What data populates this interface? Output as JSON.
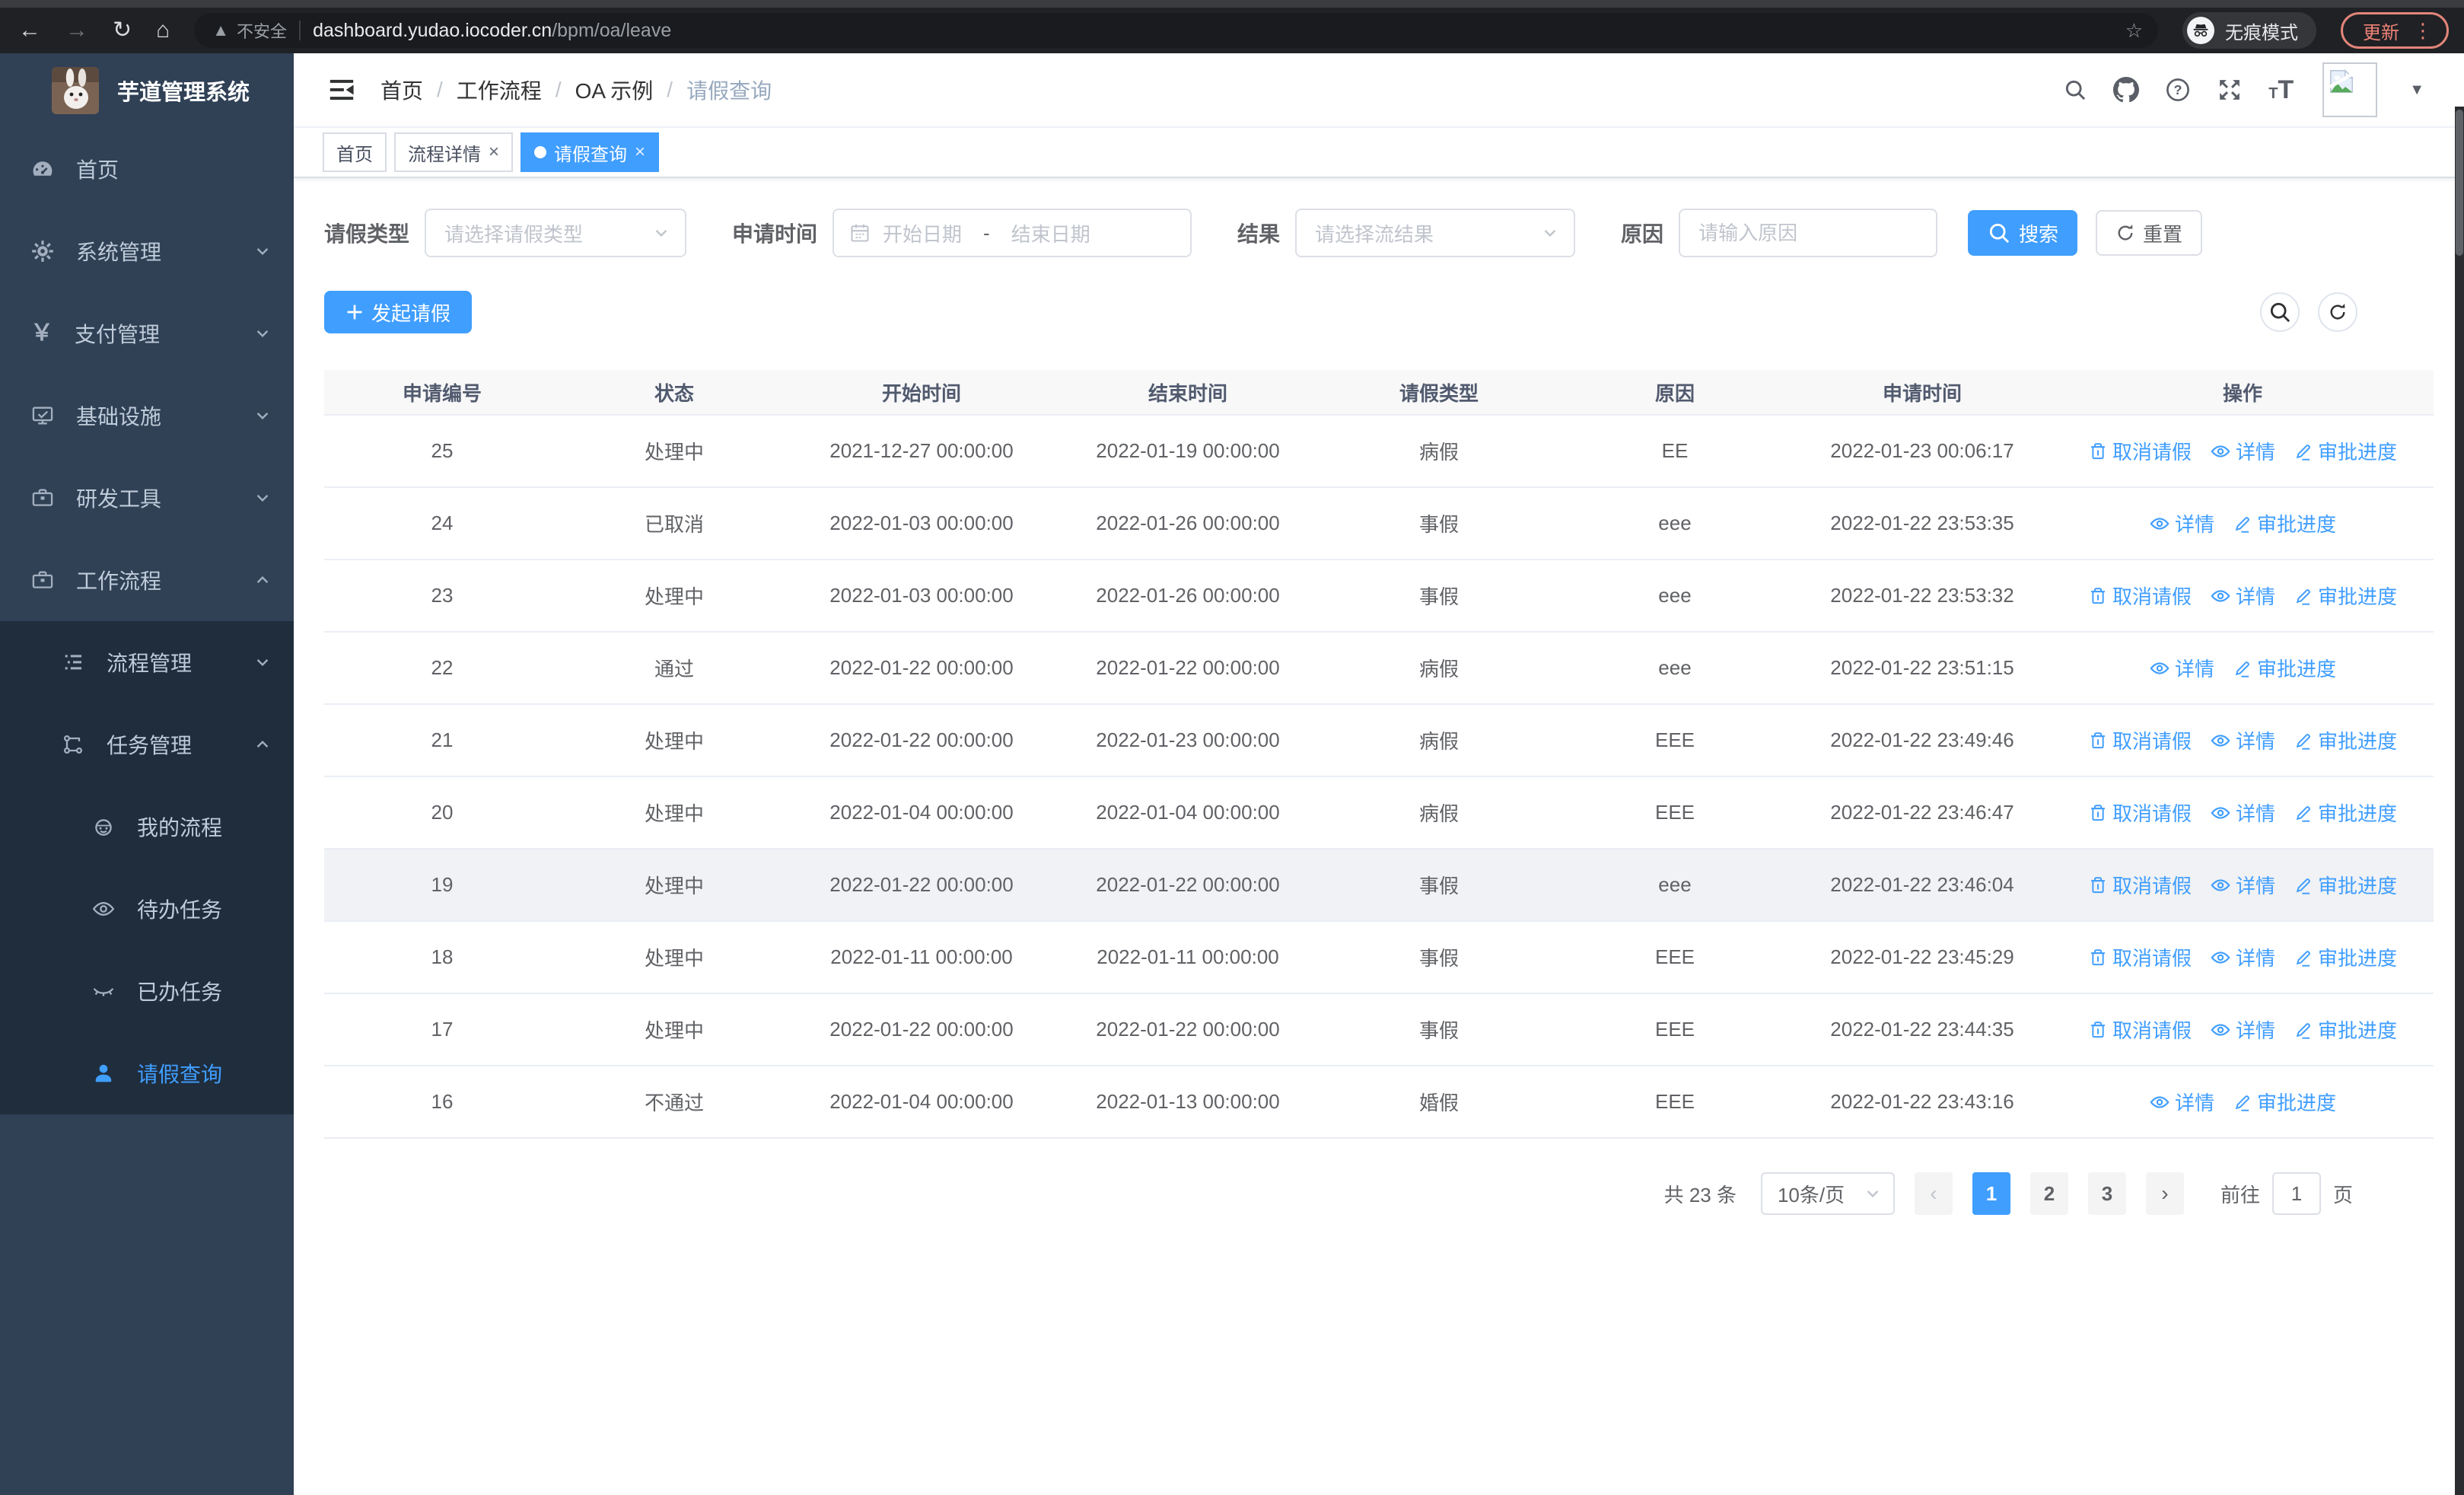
{
  "browser": {
    "security_label": "不安全",
    "url_host": "dashboard.yudao.iocoder.cn",
    "url_path": "/bpm/oa/leave",
    "incognito_label": "无痕模式",
    "update_label": "更新",
    "nav_icons": [
      "back-icon",
      "forward-icon",
      "reload-icon",
      "home-icon"
    ]
  },
  "sidebar": {
    "title": "芋道管理系统",
    "items": [
      {
        "key": "home",
        "icon": "dashboard-icon",
        "label": "首页",
        "level": 1,
        "chevron": null,
        "dark": false,
        "active": false
      },
      {
        "key": "system-management",
        "icon": "gear-icon",
        "label": "系统管理",
        "level": 1,
        "chevron": "down",
        "dark": false,
        "active": false
      },
      {
        "key": "payment-management",
        "icon": "yuan-icon",
        "label": "支付管理",
        "level": 1,
        "chevron": "down",
        "dark": false,
        "active": false
      },
      {
        "key": "infrastructure",
        "icon": "monitor-icon",
        "label": "基础设施",
        "level": 1,
        "chevron": "down",
        "dark": false,
        "active": false
      },
      {
        "key": "dev-tools",
        "icon": "toolbox-icon",
        "label": "研发工具",
        "level": 1,
        "chevron": "down",
        "dark": false,
        "active": false
      },
      {
        "key": "workflow",
        "icon": "workflow-icon",
        "label": "工作流程",
        "level": 1,
        "chevron": "up",
        "dark": false,
        "active": false
      },
      {
        "key": "process-management",
        "icon": "tree-list-icon",
        "label": "流程管理",
        "level": 2,
        "chevron": "down",
        "dark": true,
        "active": false
      },
      {
        "key": "task-management",
        "icon": "flow-icon",
        "label": "任务管理",
        "level": 2,
        "chevron": "up",
        "dark": true,
        "active": false
      },
      {
        "key": "my-process",
        "icon": "face-icon",
        "label": "我的流程",
        "level": 3,
        "chevron": null,
        "dark": true,
        "active": false
      },
      {
        "key": "todo-tasks",
        "icon": "eye-open-icon",
        "label": "待办任务",
        "level": 3,
        "chevron": null,
        "dark": true,
        "active": false
      },
      {
        "key": "done-tasks",
        "icon": "eye-closed-icon",
        "label": "已办任务",
        "level": 3,
        "chevron": null,
        "dark": true,
        "active": false
      },
      {
        "key": "leave-query",
        "icon": "user-icon",
        "label": "请假查询",
        "level": 3,
        "chevron": null,
        "dark": true,
        "active": true
      }
    ]
  },
  "breadcrumb": {
    "items": [
      "首页",
      "工作流程",
      "OA 示例",
      "请假查询"
    ]
  },
  "header_icons": [
    "search-icon",
    "github-icon",
    "help-icon",
    "fullscreen-icon",
    "font-size-icon",
    "avatar",
    "caret-down-icon"
  ],
  "tabs": [
    {
      "key": "home",
      "label": "首页",
      "closable": false,
      "active": false
    },
    {
      "key": "process-detail",
      "label": "流程详情",
      "closable": true,
      "active": false
    },
    {
      "key": "leave-query",
      "label": "请假查询",
      "closable": true,
      "active": true
    }
  ],
  "filters": {
    "leave_type_label": "请假类型",
    "leave_type_placeholder": "请选择请假类型",
    "apply_time_label": "申请时间",
    "start_date_placeholder": "开始日期",
    "range_separator": "-",
    "end_date_placeholder": "结束日期",
    "result_label": "结果",
    "result_placeholder": "请选择流结果",
    "reason_label": "原因",
    "reason_placeholder": "请输入原因",
    "search_label": "搜索",
    "reset_label": "重置"
  },
  "toolbar": {
    "create_label": "发起请假"
  },
  "table": {
    "columns": [
      "申请编号",
      "状态",
      "开始时间",
      "结束时间",
      "请假类型",
      "原因",
      "申请时间",
      "操作"
    ],
    "action_labels": {
      "cancel": "取消请假",
      "detail": "详情",
      "progress": "审批进度"
    },
    "rows": [
      {
        "id": "25",
        "status": "处理中",
        "start": "2021-12-27 00:00:00",
        "end": "2022-01-19 00:00:00",
        "type": "病假",
        "reason": "EE",
        "applied": "2022-01-23 00:06:17",
        "actions": [
          "cancel",
          "detail",
          "progress"
        ],
        "highlight": false
      },
      {
        "id": "24",
        "status": "已取消",
        "start": "2022-01-03 00:00:00",
        "end": "2022-01-26 00:00:00",
        "type": "事假",
        "reason": "eee",
        "applied": "2022-01-22 23:53:35",
        "actions": [
          "detail",
          "progress"
        ],
        "highlight": false
      },
      {
        "id": "23",
        "status": "处理中",
        "start": "2022-01-03 00:00:00",
        "end": "2022-01-26 00:00:00",
        "type": "事假",
        "reason": "eee",
        "applied": "2022-01-22 23:53:32",
        "actions": [
          "cancel",
          "detail",
          "progress"
        ],
        "highlight": false
      },
      {
        "id": "22",
        "status": "通过",
        "start": "2022-01-22 00:00:00",
        "end": "2022-01-22 00:00:00",
        "type": "病假",
        "reason": "eee",
        "applied": "2022-01-22 23:51:15",
        "actions": [
          "detail",
          "progress"
        ],
        "highlight": false
      },
      {
        "id": "21",
        "status": "处理中",
        "start": "2022-01-22 00:00:00",
        "end": "2022-01-23 00:00:00",
        "type": "病假",
        "reason": "EEE",
        "applied": "2022-01-22 23:49:46",
        "actions": [
          "cancel",
          "detail",
          "progress"
        ],
        "highlight": false
      },
      {
        "id": "20",
        "status": "处理中",
        "start": "2022-01-04 00:00:00",
        "end": "2022-01-04 00:00:00",
        "type": "病假",
        "reason": "EEE",
        "applied": "2022-01-22 23:46:47",
        "actions": [
          "cancel",
          "detail",
          "progress"
        ],
        "highlight": false
      },
      {
        "id": "19",
        "status": "处理中",
        "start": "2022-01-22 00:00:00",
        "end": "2022-01-22 00:00:00",
        "type": "事假",
        "reason": "eee",
        "applied": "2022-01-22 23:46:04",
        "actions": [
          "cancel",
          "detail",
          "progress"
        ],
        "highlight": true
      },
      {
        "id": "18",
        "status": "处理中",
        "start": "2022-01-11 00:00:00",
        "end": "2022-01-11 00:00:00",
        "type": "事假",
        "reason": "EEE",
        "applied": "2022-01-22 23:45:29",
        "actions": [
          "cancel",
          "detail",
          "progress"
        ],
        "highlight": false
      },
      {
        "id": "17",
        "status": "处理中",
        "start": "2022-01-22 00:00:00",
        "end": "2022-01-22 00:00:00",
        "type": "事假",
        "reason": "EEE",
        "applied": "2022-01-22 23:44:35",
        "actions": [
          "cancel",
          "detail",
          "progress"
        ],
        "highlight": false
      },
      {
        "id": "16",
        "status": "不通过",
        "start": "2022-01-04 00:00:00",
        "end": "2022-01-13 00:00:00",
        "type": "婚假",
        "reason": "EEE",
        "applied": "2022-01-22 23:43:16",
        "actions": [
          "detail",
          "progress"
        ],
        "highlight": false
      }
    ]
  },
  "pagination": {
    "total_label": "共 23 条",
    "page_size": "10条/页",
    "pages": [
      "1",
      "2",
      "3"
    ],
    "active_page": "1",
    "goto_label": "前往",
    "goto_value": "1",
    "page_unit": "页"
  },
  "colors": {
    "accent": "#409eff",
    "sidebar_bg": "#304156",
    "submenu_bg": "#1f2d3d",
    "update_button": "#ee8277",
    "table_header_bg": "#f8f8f9",
    "row_highlight": "#f0f2f5"
  }
}
